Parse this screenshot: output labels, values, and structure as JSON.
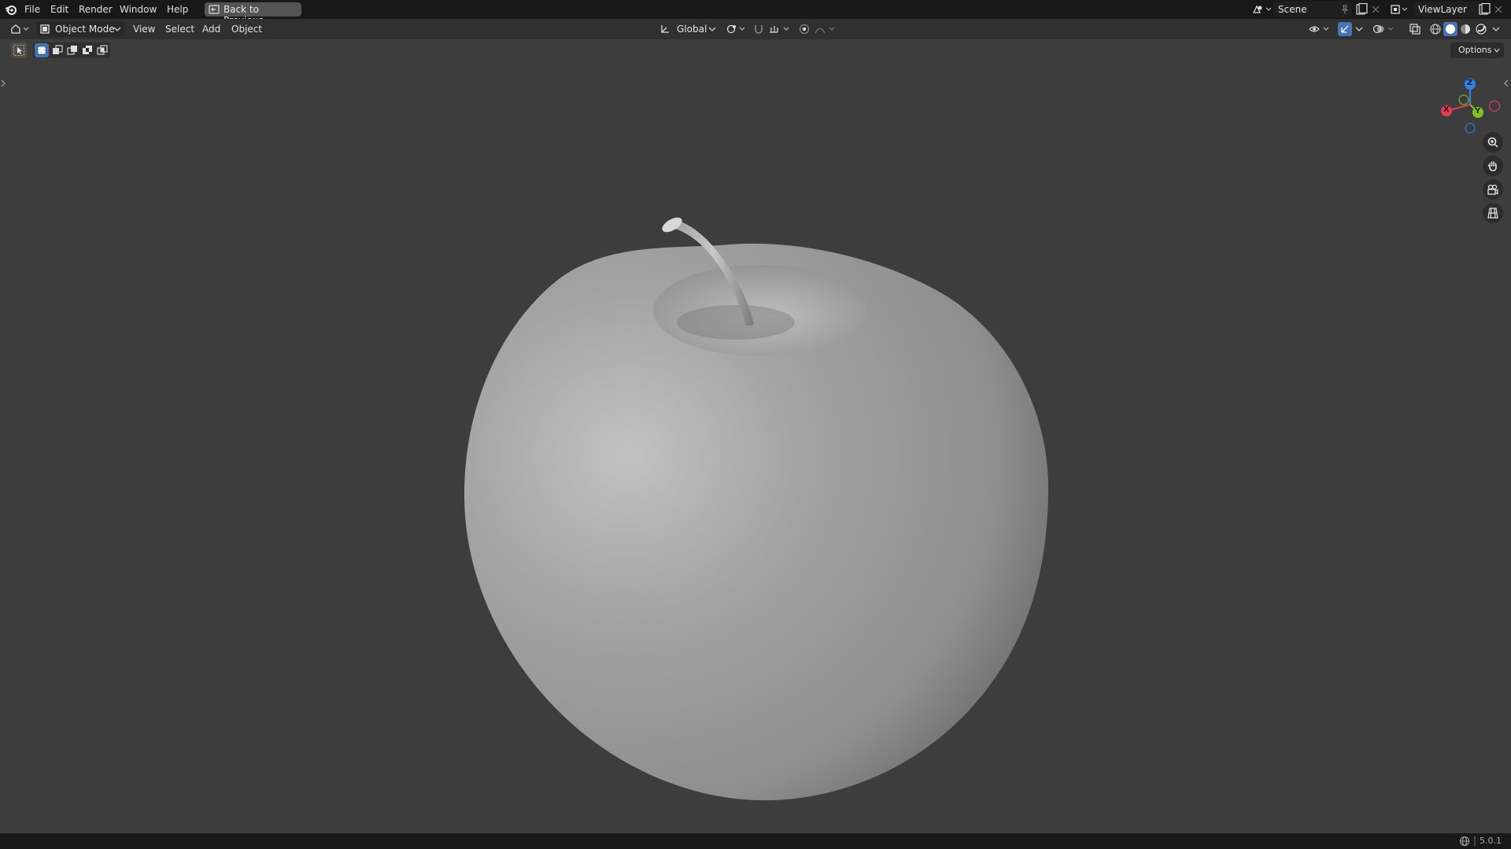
{
  "menu": {
    "file": "File",
    "edit": "Edit",
    "render": "Render",
    "window": "Window",
    "help": "Help",
    "back_to_previous": "Back to Previous"
  },
  "workspace": {
    "scene_label": "Scene",
    "view_layer_label": "ViewLayer"
  },
  "viewport_header": {
    "mode": "Object Mode",
    "view": "View",
    "select": "Select",
    "add": "Add",
    "object": "Object",
    "transform_orientation": "Global",
    "options": "Options"
  },
  "gizmo": {
    "x": "X",
    "y": "Y",
    "z": "Z"
  },
  "status": {
    "version": "5.0.1"
  },
  "icons": {
    "blender_logo": "blender-logo-icon",
    "zoom": "zoom-icon",
    "pan": "hand-pan-icon",
    "camera": "camera-icon",
    "ortho": "grid-ortho-icon"
  },
  "colors": {
    "x_axis": "#e33d55",
    "y_axis": "#85c21e",
    "z_axis": "#2f84e6",
    "active_blue": "#4772b3"
  }
}
